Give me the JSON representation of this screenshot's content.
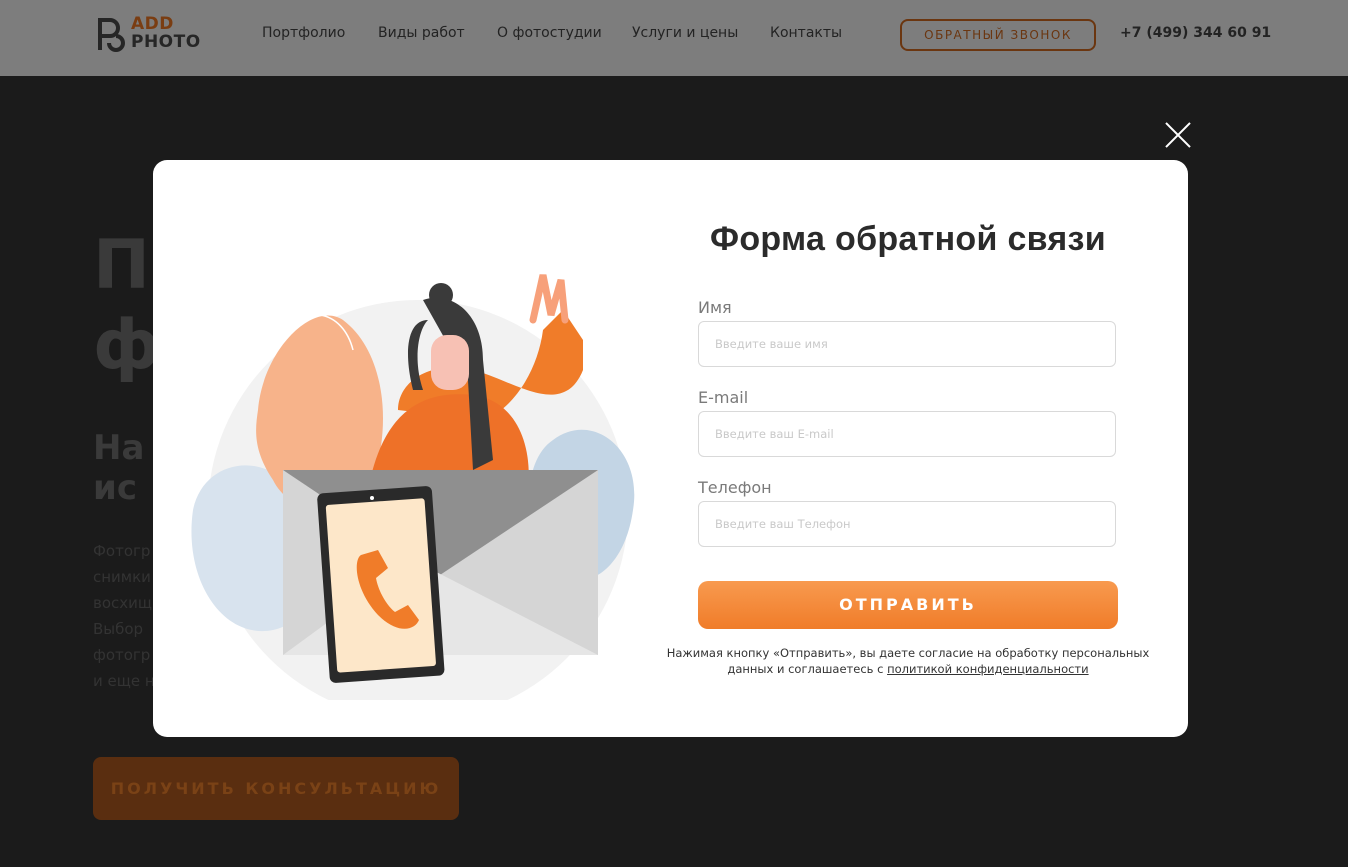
{
  "header": {
    "logo": {
      "line1": "ADD",
      "line2": "PHOTO"
    },
    "nav": [
      "Портфолио",
      "Виды работ",
      "О фотостудии",
      "Услуги и цены",
      "Контакты"
    ],
    "callback_label": "ОБРАТНЫЙ ЗВОНОК",
    "phone": "+7 (499) 344 60 91"
  },
  "hero": {
    "title": "П\nф",
    "subtitle": "На\nис",
    "paragraph": [
      "Фотогр",
      "снимки",
      "восхищ",
      "Выбор",
      "фотогр",
      "и еще н"
    ],
    "button_label": "ПОЛУЧИТЬ КОНСУЛЬТАЦИЮ"
  },
  "modal": {
    "title": "Форма обратной связи",
    "fields": {
      "name": {
        "label": "Имя",
        "placeholder": "Введите ваше имя"
      },
      "email": {
        "label": "E-mail",
        "placeholder": "Введите ваш E-mail"
      },
      "phone": {
        "label": "Телефон",
        "placeholder": "Введите ваш Телефон"
      }
    },
    "submit_label": "ОТПРАВИТЬ",
    "consent_text": "Нажимая кнопку «Отправить», вы даете согласие на обработку персональных данных и соглашаетесь с",
    "consent_link": "политикой конфиденциальности"
  },
  "colors": {
    "accent": "#f07c29",
    "accent_light": "#f89a4f",
    "dark": "#1b1b1b"
  }
}
